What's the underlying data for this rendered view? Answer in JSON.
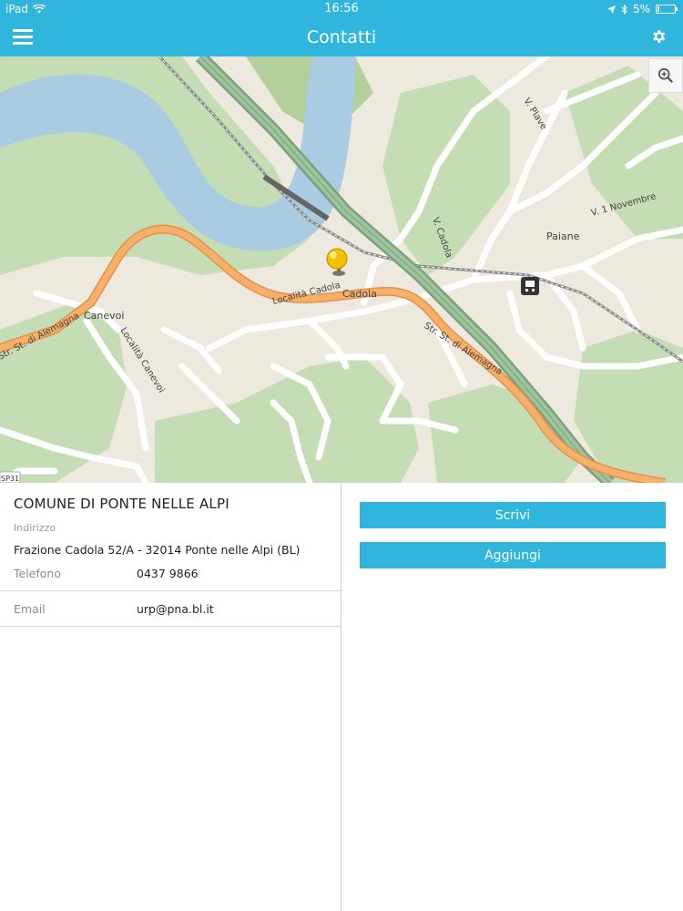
{
  "status_bar": {
    "device": "iPad",
    "time": "16:56",
    "battery": "5%"
  },
  "header": {
    "title": "Contatti",
    "menu_icon": "hamburger-menu-icon",
    "settings_icon": "gear-icon"
  },
  "map": {
    "zoom_icon": "magnifier-icon",
    "labels": {
      "v_plave": "V. Plave",
      "v_1_novembre": "V. 1 Novembre",
      "paiane": "Paiane",
      "v_cadola": "V. Cadola",
      "cadola": "Cadola",
      "localita_cadola": "Località Cadola",
      "canevoi": "Canevoi",
      "localita_canevoi": "Località Canevoi",
      "str_alemagna_left": "Str. St. di Alemagna",
      "str_alemagna_right": "Str. St. di Alemagna",
      "sp31": "SP31"
    },
    "colors": {
      "land": "#ede9df",
      "green": "#c5ddb4",
      "water": "#a9cce3",
      "main_road": "#f1a456",
      "highway": "#8fb58d",
      "rail": "#8a8a8a"
    }
  },
  "contact": {
    "org_name": "COMUNE DI PONTE NELLE ALPI",
    "address_label": "Indirizzo",
    "address_value": "Frazione Cadola 52/A - 32014 Ponte nelle Alpi (BL)",
    "phone_label": "Telefono",
    "phone_value": "0437 9866",
    "email_label": "Email",
    "email_value": "urp@pna.bl.it"
  },
  "actions": {
    "write_label": "Scrivi",
    "add_label": "Aggiungi"
  },
  "colors": {
    "accent": "#30b6dc"
  }
}
